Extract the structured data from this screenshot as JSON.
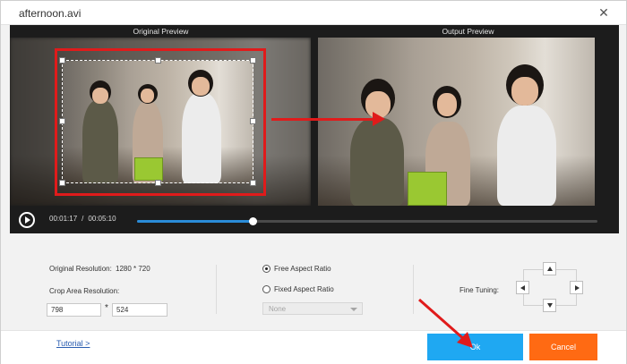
{
  "window": {
    "title": "afternoon.avi"
  },
  "preview": {
    "original_label": "Original Preview",
    "output_label": "Output Preview"
  },
  "playback": {
    "current_time": "00:01:17",
    "separator": "/",
    "total_time": "00:05:10",
    "progress_fraction": 0.25
  },
  "settings": {
    "original_resolution_label": "Original Resolution:",
    "original_resolution_value": "1280 * 720",
    "crop_area_label": "Crop Area Resolution:",
    "crop_width": "798",
    "crop_times": "*",
    "crop_height": "524",
    "free_aspect_label": "Free Aspect Ratio",
    "fixed_aspect_label": "Fixed Aspect Ratio",
    "aspect_select_value": "None",
    "fine_tuning_label": "Fine Tuning:"
  },
  "footer": {
    "tutorial_link": "Tutorial >",
    "ok_label": "Ok",
    "cancel_label": "Cancel"
  },
  "colors": {
    "ok_button": "#1fa8f2",
    "cancel_button": "#ff6a13",
    "annotation_red": "#e01b1b",
    "progress": "#2a8cd8"
  },
  "icons": {
    "close": "close-icon",
    "play": "play-icon"
  }
}
